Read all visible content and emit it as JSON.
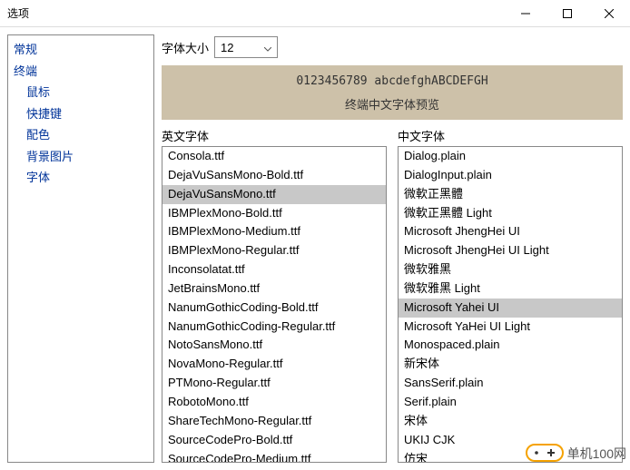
{
  "titlebar": {
    "title": "选项"
  },
  "sidebar": {
    "items": [
      {
        "label": "常规",
        "level": 0
      },
      {
        "label": "终端",
        "level": 0
      },
      {
        "label": "鼠标",
        "level": 1
      },
      {
        "label": "快捷键",
        "level": 1
      },
      {
        "label": "配色",
        "level": 1
      },
      {
        "label": "背景图片",
        "level": 1
      },
      {
        "label": "字体",
        "level": 1
      }
    ]
  },
  "fontsize": {
    "label": "字体大小",
    "value": "12"
  },
  "preview": {
    "line1": "0123456789 abcdefghABCDEFGH",
    "line2": "终端中文字体预览"
  },
  "english_fonts": {
    "header": "英文字体",
    "selected": "DejaVuSansMono.ttf",
    "items": [
      "Consola.ttf",
      "DejaVuSansMono-Bold.ttf",
      "DejaVuSansMono.ttf",
      "IBMPlexMono-Bold.ttf",
      "IBMPlexMono-Medium.ttf",
      "IBMPlexMono-Regular.ttf",
      "Inconsolatat.ttf",
      "JetBrainsMono.ttf",
      "NanumGothicCoding-Bold.ttf",
      "NanumGothicCoding-Regular.ttf",
      "NotoSansMono.ttf",
      "NovaMono-Regular.ttf",
      "PTMono-Regular.ttf",
      "RobotoMono.ttf",
      "ShareTechMono-Regular.ttf",
      "SourceCodePro-Bold.ttf",
      "SourceCodePro-Medium.ttf"
    ]
  },
  "chinese_fonts": {
    "header": "中文字体",
    "selected": "Microsoft Yahei UI",
    "items": [
      "Dialog.plain",
      "DialogInput.plain",
      "微軟正黑體",
      "微軟正黑體 Light",
      "Microsoft JhengHei UI",
      "Microsoft JhengHei UI Light",
      "微软雅黑",
      "微软雅黑 Light",
      "Microsoft Yahei UI",
      "Microsoft YaHei UI Light",
      "Monospaced.plain",
      "新宋体",
      "SansSerif.plain",
      "Serif.plain",
      "宋体",
      "UKIJ CJK",
      "仿宋"
    ]
  },
  "watermark": {
    "text": "单机100网"
  }
}
